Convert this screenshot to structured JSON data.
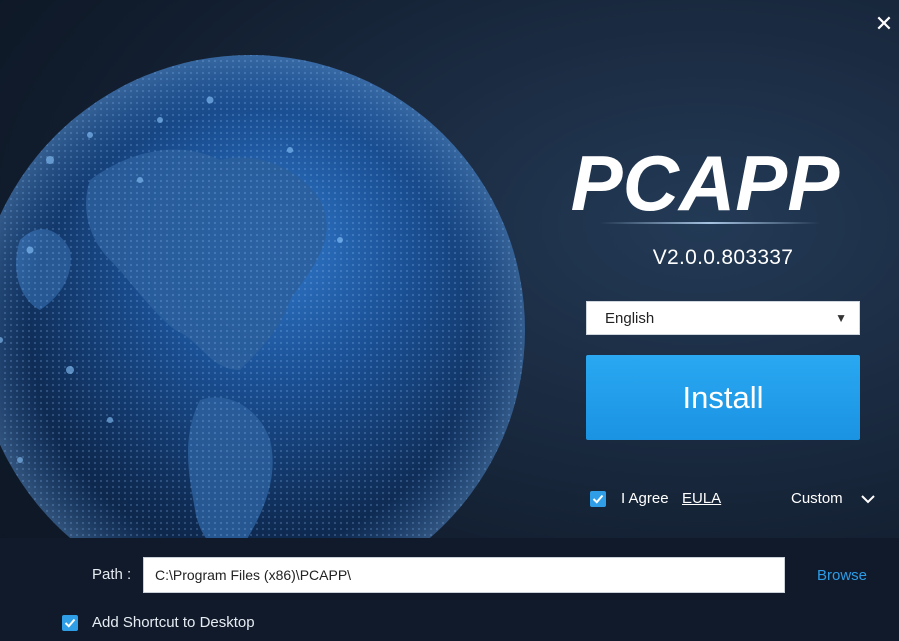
{
  "window": {
    "close_icon": "close-icon",
    "close_glyph": "✕"
  },
  "app": {
    "logo_text": "PCAPP",
    "version": "V2.0.0.803337"
  },
  "language": {
    "selected": "English",
    "caret_icon": "caret-down-icon"
  },
  "install": {
    "label": "Install"
  },
  "agreement": {
    "checked": true,
    "label": "I Agree",
    "link": "EULA"
  },
  "custom": {
    "label": "Custom",
    "icon": "chevron-down-icon"
  },
  "path": {
    "label": "Path :",
    "value": "C:\\Program Files (x86)\\PCAPP\\",
    "browse_label": "Browse"
  },
  "shortcut": {
    "checked": true,
    "label": "Add Shortcut to Desktop"
  },
  "colors": {
    "accent": "#1a93e3",
    "link": "#2d9ce6",
    "background": "#101b2b"
  }
}
